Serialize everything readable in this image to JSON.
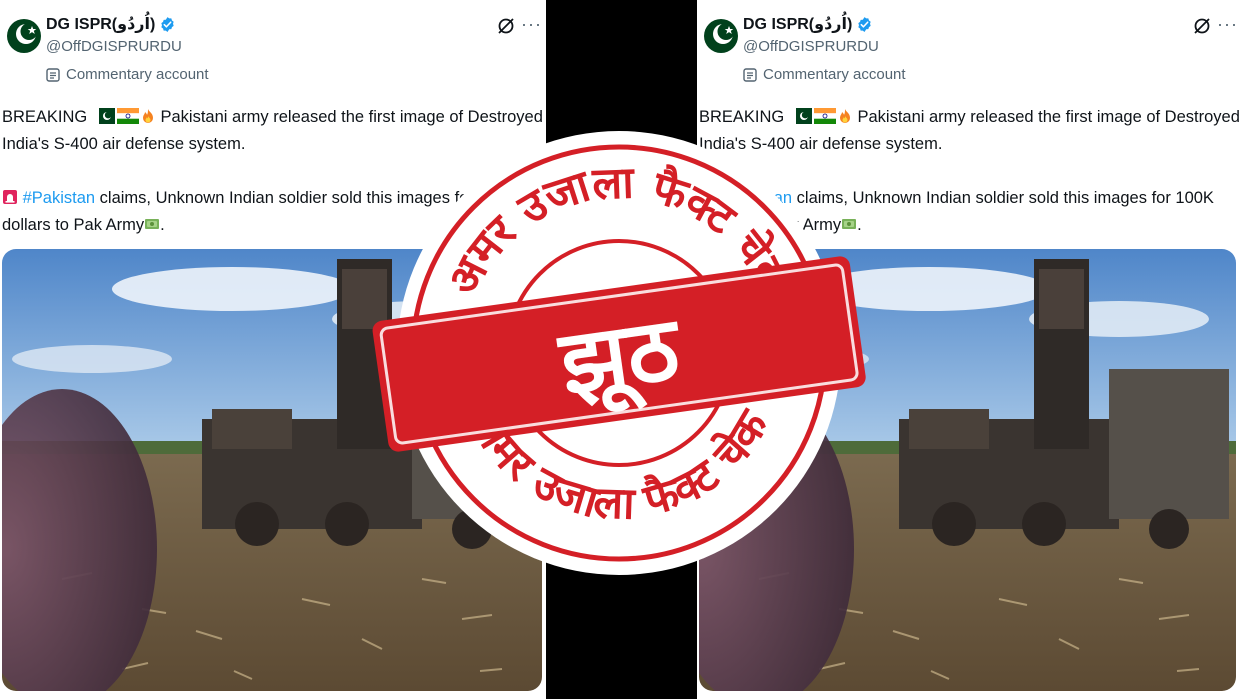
{
  "tweet": {
    "display_name": "DG ISPR(اُردُو)",
    "handle": "@OffDGISPRURDU",
    "commentary_label": "Commentary account",
    "line1_prefix": "BREAKING",
    "line1_suffix": "Pakistani army released the first image of Destroyed",
    "line2": "India's S-400 air defense system.",
    "hashtag": "#Pakistan",
    "line3_suffix": "claims, Unknown Indian soldier sold this images for 100K",
    "line4_prefix": "dollars to Pak Army",
    "line4_suffix": "."
  },
  "icons": {
    "avatar": "pakistan-flag-avatar",
    "verified": "verified-badge-icon",
    "commentary": "commentary-shield-icon",
    "grok": "grok-icon",
    "more": "more-options-icon",
    "siren": "siren-emoji",
    "fire": "fire-emoji",
    "money": "money-emoji"
  },
  "stamp": {
    "top_arc_text": "अमर उजाला फैक्ट चेक",
    "bottom_arc_text": "अमर उजाला फैक्ट चेक",
    "verdict": "झूठ"
  },
  "colors": {
    "stamp_red": "#d41f26",
    "link_blue": "#1d9bf0",
    "secondary_text": "#536471",
    "divider": "#000000"
  }
}
